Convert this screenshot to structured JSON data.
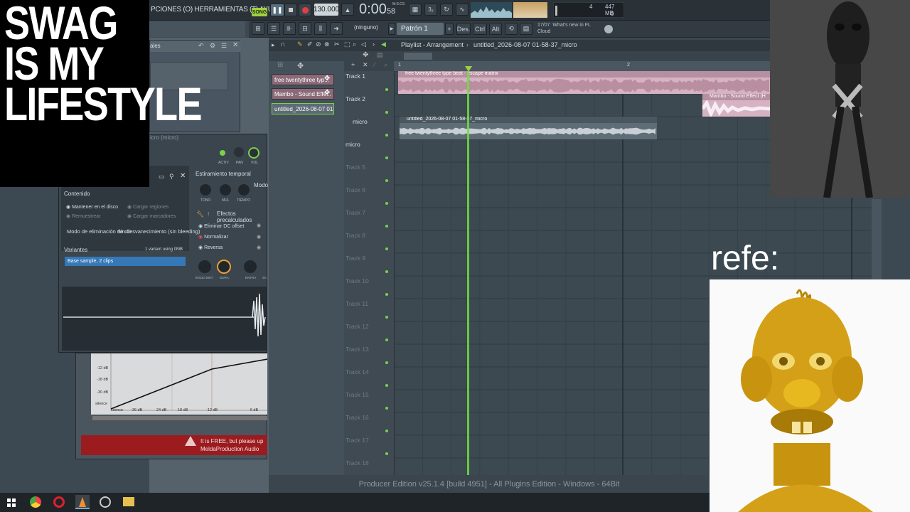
{
  "overlays": {
    "meme_text_lines": [
      "SWAG",
      "IS MY",
      "LIFESTYLE"
    ],
    "refe_label": "refe:"
  },
  "toolbar": {
    "menu": "PCIONES (O) HERRAMIENTAS (T) AYUDA",
    "song_badge": "SONG",
    "tempo": "130.000",
    "time_main": "0:00",
    "time_sub": "58",
    "time_unit": "M:S:CS",
    "cpu_value": "4",
    "memory": "447 MB",
    "voices": "0"
  },
  "toolbar2": {
    "snap": "(ninguno)",
    "pattern": "Patrón 1",
    "des": "Des.",
    "ctrl": "Ctrl",
    "alt": "Alt",
    "news_date": "17/07",
    "news_title": "What's new in FL",
    "news_sub": "Cloud"
  },
  "playlist": {
    "breadcrumb": "Playlist - Arrangement",
    "file": "untitled_2026-08-07 01-58-37_micro",
    "ruler_marks": [
      "1",
      "2"
    ],
    "picker_items": [
      "free twentythree typ...",
      "Mambo - Sound Effe...",
      "untitled_2026-08-07 01-..."
    ],
    "tracks": [
      "Track 1",
      "Track 2",
      "micro",
      "micro",
      "Track 5",
      "Track 6",
      "Track 7",
      "Track 8",
      "Track 9",
      "Track 10",
      "Track 11",
      "Track 12",
      "Track 13",
      "Track 14",
      "Track 15",
      "Track 16",
      "Track 17",
      "Track 18"
    ],
    "clips": [
      "free twentythree type beat - escape matrix",
      "Mambo - Sound Effect (H",
      "untitled_2026-08-07 01-58-37_micro"
    ]
  },
  "sampler_top": {
    "label": "ales"
  },
  "channel_dialog": {
    "title": "icro (micro)",
    "knob_labels": [
      "ACTIV",
      "PAN",
      "VOL"
    ],
    "section_contenido": "Contenido",
    "opt_mantener": "Mantener en el disco",
    "opt_cargar_regiones": "Cargar regiones",
    "opt_remuestrear": "Remuestrear",
    "opt_cargar_marcadores": "Cargar marcadores",
    "section_estiramiento": "Estiramiento temporal",
    "estir_knobs": [
      "TONO",
      "MUL",
      "TIEMPO"
    ],
    "modo_label": "Modo",
    "modo_elim": "Modo de eliminación de clic",
    "modo_elim_value": "Sin desvanecimiento (sin bleeding)",
    "efectos": "Efectos precalculados",
    "fx1": "Eliminar DC offset",
    "fx2": "Normalizar",
    "fx3": "Reversa",
    "variantes": "Variantes",
    "variant_info": "1 variant using 0MB",
    "variant_item": "Base sample, 2 clips",
    "bottom_knobs": [
      "INICIO MST",
      "DURA.",
      "ENTRA",
      "SA"
    ]
  },
  "melda": {
    "db_labels": [
      "-12 dB",
      "-18 dB",
      "-30 dB",
      "silence"
    ],
    "x_labels": [
      "silence",
      "-36 dB",
      "24 dB",
      "18 dB",
      "-12 dB",
      "-6 dB"
    ],
    "banner_line1": "It is FREE, but please up",
    "banner_line2": "MeldaProduction Audio"
  },
  "status": {
    "text": "Producer Edition v25.1.4 [build 4951] - All Plugins Edition - Windows - 64Bit"
  },
  "colors": {
    "clip_pink": "#d9a9bd",
    "clip_gray": "#5d6c76",
    "accent_green": "#7bd04c",
    "playhead": "#6fe040"
  }
}
